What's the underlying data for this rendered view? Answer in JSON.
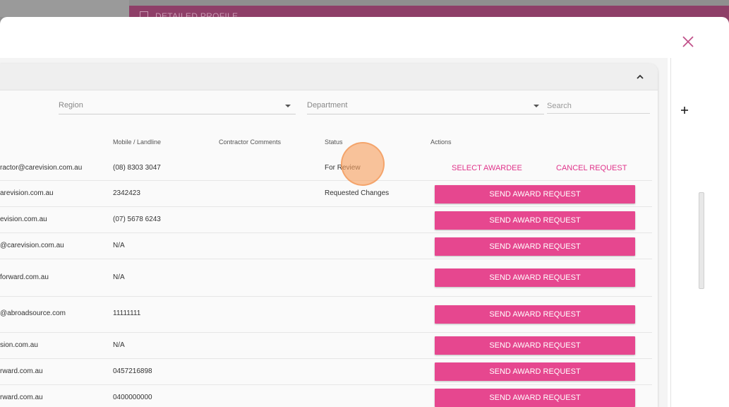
{
  "background": {
    "title": "DETAILED PROFILE"
  },
  "filters": {
    "region_placeholder": "Region",
    "department_placeholder": "Department",
    "search_placeholder": "Search"
  },
  "columns": {
    "mobile": "Mobile / Landline",
    "comments": "Contractor Comments",
    "status": "Status",
    "actions": "Actions"
  },
  "rows": [
    {
      "email": "ractor@carevision.com.au",
      "phone": "(08) 8303 3047",
      "comments": "",
      "status": "For Review",
      "actions": [
        "SELECT AWARDEE",
        "CANCEL REQUEST"
      ]
    },
    {
      "email": "arevision.com.au",
      "phone": "2342423",
      "comments": "",
      "status": "Requested Changes",
      "action": "SEND AWARD REQUEST"
    },
    {
      "email": "evision.com.au",
      "phone": "(07) 5678 6243",
      "comments": "",
      "status": "",
      "action": "SEND AWARD REQUEST"
    },
    {
      "email": "@carevision.com.au",
      "phone": "N/A",
      "comments": "",
      "status": "",
      "action": "SEND AWARD REQUEST"
    },
    {
      "email": "forward.com.au",
      "phone": "N/A",
      "comments": "",
      "status": "",
      "action": "SEND AWARD REQUEST"
    },
    {
      "email": "@abroadsource.com",
      "phone": "11111111",
      "comments": "",
      "status": "",
      "action": "SEND AWARD REQUEST"
    },
    {
      "email": "sion.com.au",
      "phone": "N/A",
      "comments": "",
      "status": "",
      "action": "SEND AWARD REQUEST"
    },
    {
      "email": "rward.com.au",
      "phone": "0457216898",
      "comments": "",
      "status": "",
      "action": "SEND AWARD REQUEST"
    },
    {
      "email": "rward.com.au",
      "phone": "0400000000",
      "comments": "",
      "status": "",
      "action": "SEND AWARD REQUEST"
    }
  ],
  "icons": {
    "close": "close-icon",
    "collapse": "chevron-up-icon",
    "add": "plus-icon"
  },
  "colors": {
    "accent": "#e6478f",
    "link": "#e0338a",
    "header_bar": "#8e3f68"
  }
}
